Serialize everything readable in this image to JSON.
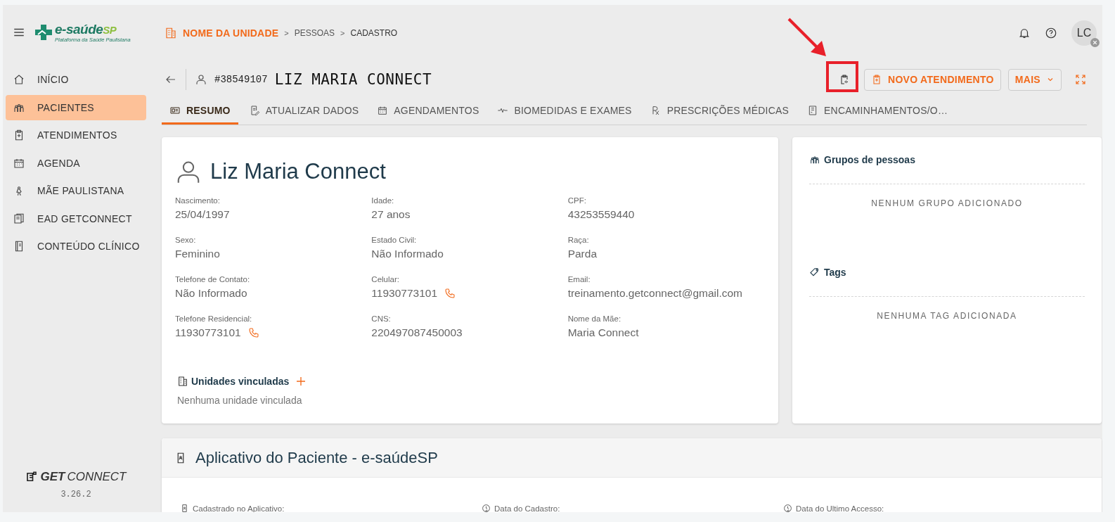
{
  "logo": {
    "name": "e-saúde",
    "suffix": "SP",
    "tagline": "Plataforma da Saúde Paulistana"
  },
  "breadcrumb": [
    "NOME DA UNIDADE",
    "PESSOAS",
    "CADASTRO"
  ],
  "breadcrumb_separators": [
    ">",
    ">"
  ],
  "user": {
    "initials": "LC"
  },
  "sidebar": {
    "items": [
      {
        "label": "INÍCIO",
        "selected": false
      },
      {
        "label": "PACIENTES",
        "selected": true
      },
      {
        "label": "ATENDIMENTOS",
        "selected": false
      },
      {
        "label": "AGENDA",
        "selected": false
      },
      {
        "label": "MÃE PAULISTANA",
        "selected": false
      },
      {
        "label": "EAD GETCONNECT",
        "selected": false
      },
      {
        "label": "CONTEÚDO CLÍNICO",
        "selected": false
      }
    ],
    "brand_bold": "GET",
    "brand_light": "CONNECT",
    "version": "3.26.2"
  },
  "patient_header": {
    "id": "#38549107",
    "name": "LIZ MARIA CONNECT"
  },
  "actions": {
    "primary": "NOVO ATENDIMENTO",
    "more": "MAIS"
  },
  "tabs": [
    {
      "label": "RESUMO",
      "selected": true
    },
    {
      "label": "ATUALIZAR DADOS",
      "selected": false
    },
    {
      "label": "AGENDAMENTOS",
      "selected": false
    },
    {
      "label": "BIOMEDIDAS E EXAMES",
      "selected": false
    },
    {
      "label": "PRESCRIÇÕES MÉDICAS",
      "selected": false
    },
    {
      "label": "ENCAMINHAMENTOS/O…",
      "selected": false
    }
  ],
  "summary": {
    "name": "Liz Maria Connect",
    "fields": [
      {
        "label": "Nascimento:",
        "value": "25/04/1997",
        "callable": false
      },
      {
        "label": "Idade:",
        "value": "27 anos",
        "callable": false
      },
      {
        "label": "CPF:",
        "value": "43253559440",
        "callable": false
      },
      {
        "label": "Sexo:",
        "value": "Feminino",
        "callable": false
      },
      {
        "label": "Estado Civil:",
        "value": "Não Informado",
        "callable": false
      },
      {
        "label": "Raça:",
        "value": "Parda",
        "callable": false
      },
      {
        "label": "Telefone de Contato:",
        "value": "Não Informado",
        "callable": false
      },
      {
        "label": "Celular:",
        "value": "11930773101",
        "callable": true
      },
      {
        "label": "Email:",
        "value": "treinamento.getconnect@gmail.com",
        "callable": false
      },
      {
        "label": "Telefone Residencial:",
        "value": "11930773101",
        "callable": true
      },
      {
        "label": "CNS:",
        "value": "220497087450003",
        "callable": false
      },
      {
        "label": "Nome da Mãe:",
        "value": "Maria Connect",
        "callable": false
      }
    ],
    "units_title": "Unidades vinculadas",
    "units_empty": "Nenhuma unidade vinculada"
  },
  "side_panel": {
    "sections": [
      {
        "title": "Grupos de pessoas",
        "empty": "NENHUM GRUPO ADICIONADO"
      },
      {
        "title": "Tags",
        "empty": "NENHUMA TAG ADICIONADA"
      }
    ]
  },
  "app_card": {
    "title": "Aplicativo do Paciente - e-saúdeSP",
    "fields": [
      {
        "label": "Cadastrado no Aplicativo:"
      },
      {
        "label": "Data do Cadastro:"
      },
      {
        "label": "Data do Ultimo Accesso:"
      }
    ]
  }
}
